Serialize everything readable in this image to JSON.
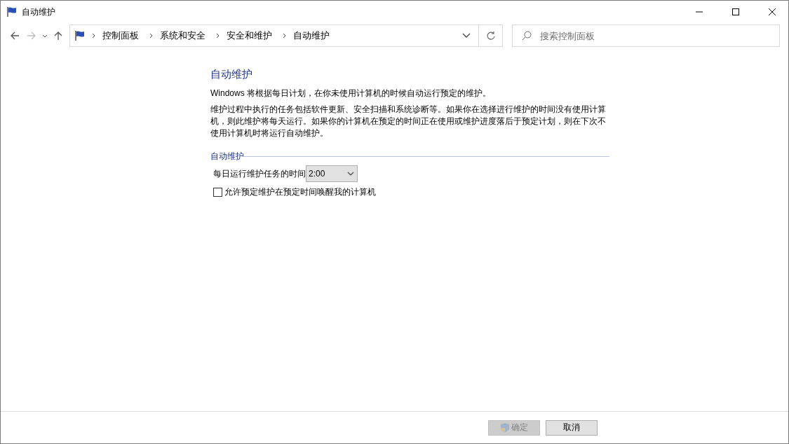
{
  "window": {
    "title": "自动维护"
  },
  "address_bar": {
    "breadcrumbs": [
      "控制面板",
      "系统和安全",
      "安全和维护",
      "自动维护"
    ]
  },
  "search": {
    "placeholder": "搜索控制面板"
  },
  "content": {
    "heading": "自动维护",
    "intro": "Windows 将根据每日计划，在你未使用计算机的时候自动运行预定的维护。",
    "description": "维护过程中执行的任务包括软件更新、安全扫描和系统诊断等。如果你在选择进行维护的时间没有使用计算机，则此维护将每天运行。如果你的计算机在预定的时间正在使用或维护进度落后于预定计划，则在下次不使用计算机时将运行自动维护。",
    "group_label": "自动维护",
    "time_label": "每日运行维护任务的时间",
    "time_value": "2:00",
    "wake_checkbox": {
      "label": "允许预定维护在预定时间唤醒我的计算机",
      "checked": false
    }
  },
  "buttons": [
    {
      "label": "确定",
      "disabled": true,
      "kind": "shield"
    },
    {
      "label": "取消",
      "disabled": false,
      "kind": "plain"
    }
  ]
}
